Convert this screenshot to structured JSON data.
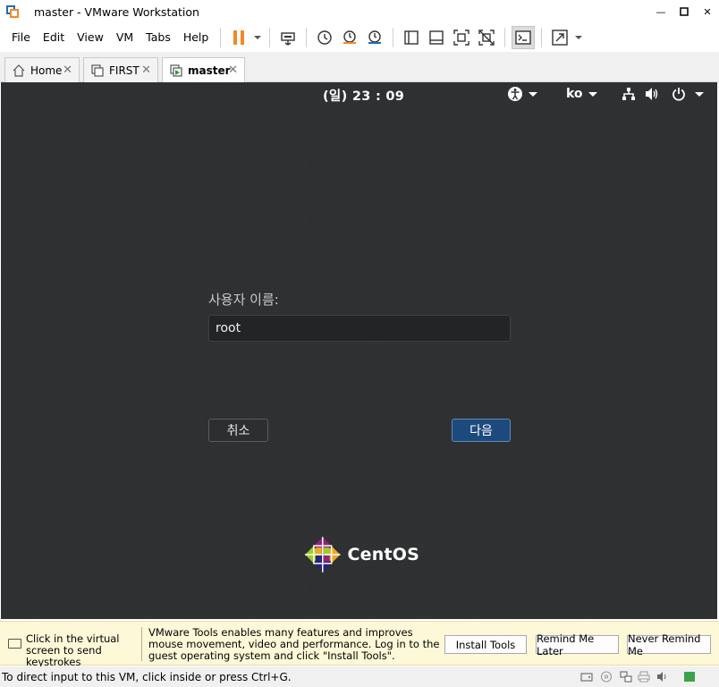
{
  "window": {
    "title": "master - VMware Workstation"
  },
  "menu": [
    "File",
    "Edit",
    "View",
    "VM",
    "Tabs",
    "Help"
  ],
  "tabs": [
    {
      "label": "Home",
      "icon": "home-icon"
    },
    {
      "label": "FIRST",
      "icon": "vm-icon"
    },
    {
      "label": "master",
      "icon": "vm-running-icon",
      "active": true
    }
  ],
  "vm": {
    "clock": "(일) 23 : 09",
    "language": "ko",
    "login": {
      "username_label": "사용자 이름:",
      "username_value": "root",
      "cancel_label": "취소",
      "next_label": "다음"
    },
    "brand": "CentOS"
  },
  "notification": {
    "hint": "Click in the virtual screen to send keystrokes",
    "message": "VMware Tools enables many features and improves mouse movement, video and performance. Log in to the guest operating system and click \"Install Tools\".",
    "buttons": [
      "Install Tools",
      "Remind Me Later",
      "Never Remind Me"
    ]
  },
  "status": {
    "text": "To direct input to this VM, click inside or press Ctrl+G."
  },
  "colors": {
    "accent_pause": "#f08a24",
    "vm_background": "#2d2f31",
    "next_button": "#1d4a7c",
    "notify_bg": "#fdf8d8"
  }
}
